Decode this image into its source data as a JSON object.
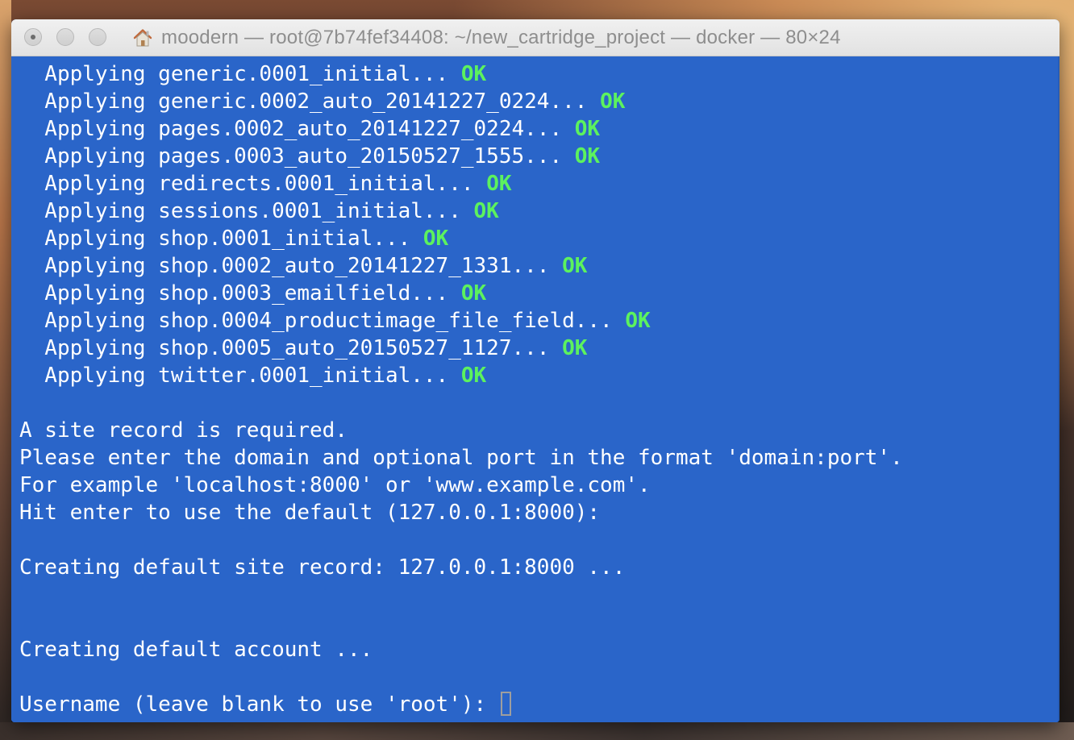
{
  "window": {
    "title": "moodern — root@7b74fef34408: ~/new_cartridge_project — docker — 80×24",
    "home_icon": "home-icon"
  },
  "colors": {
    "terminal_background": "#2a65c9",
    "text": "#ffffff",
    "ok": "#5cf25e"
  },
  "terminal": {
    "migrations": [
      {
        "text": "  Applying generic.0001_initial... ",
        "status": "OK"
      },
      {
        "text": "  Applying generic.0002_auto_20141227_0224... ",
        "status": "OK"
      },
      {
        "text": "  Applying pages.0002_auto_20141227_0224... ",
        "status": "OK"
      },
      {
        "text": "  Applying pages.0003_auto_20150527_1555... ",
        "status": "OK"
      },
      {
        "text": "  Applying redirects.0001_initial... ",
        "status": "OK"
      },
      {
        "text": "  Applying sessions.0001_initial... ",
        "status": "OK"
      },
      {
        "text": "  Applying shop.0001_initial... ",
        "status": "OK"
      },
      {
        "text": "  Applying shop.0002_auto_20141227_1331... ",
        "status": "OK"
      },
      {
        "text": "  Applying shop.0003_emailfield... ",
        "status": "OK"
      },
      {
        "text": "  Applying shop.0004_productimage_file_field... ",
        "status": "OK"
      },
      {
        "text": "  Applying shop.0005_auto_20150527_1127... ",
        "status": "OK"
      },
      {
        "text": "  Applying twitter.0001_initial... ",
        "status": "OK"
      }
    ],
    "site_record_required": "A site record is required.",
    "enter_domain": "Please enter the domain and optional port in the format 'domain:port'.",
    "example": "For example 'localhost:8000' or 'www.example.com'.",
    "hit_enter": "Hit enter to use the default (127.0.0.1:8000):",
    "creating_site": "Creating default site record: 127.0.0.1:8000 ...",
    "creating_account": "Creating default account ...",
    "username_prompt": "Username (leave blank to use 'root'): "
  }
}
